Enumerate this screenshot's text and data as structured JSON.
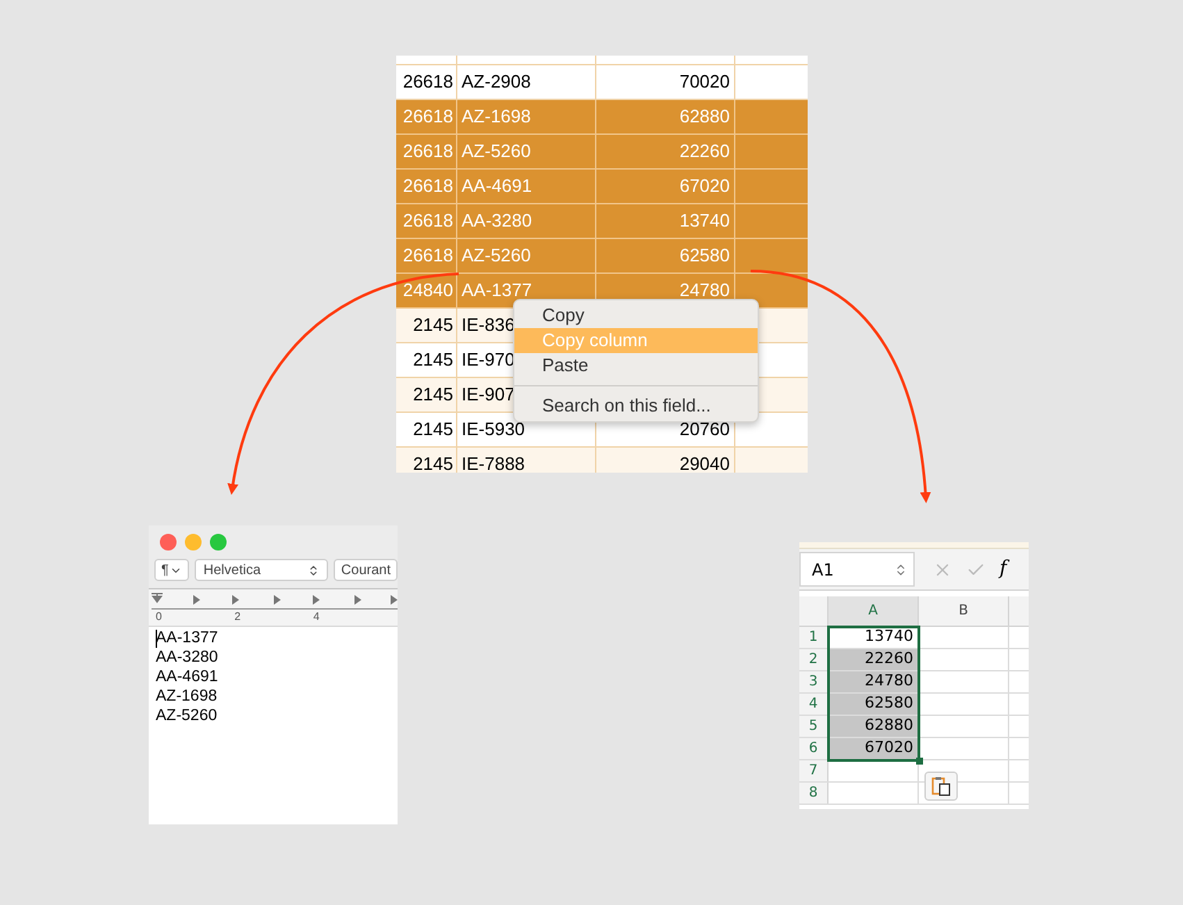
{
  "table": {
    "rows": [
      {
        "id": "26618",
        "code": "AZ-2908",
        "amount": "70020",
        "selected": false
      },
      {
        "id": "26618",
        "code": "AZ-1698",
        "amount": "62880",
        "selected": true
      },
      {
        "id": "26618",
        "code": "AZ-5260",
        "amount": "22260",
        "selected": true
      },
      {
        "id": "26618",
        "code": "AA-4691",
        "amount": "67020",
        "selected": true
      },
      {
        "id": "26618",
        "code": "AA-3280",
        "amount": "13740",
        "selected": true
      },
      {
        "id": "26618",
        "code": "AZ-5260",
        "amount": "62580",
        "selected": true
      },
      {
        "id": "24840",
        "code": "AA-1377",
        "amount": "24780",
        "selected": true
      },
      {
        "id": "2145",
        "code": "IE-836",
        "selected": false
      },
      {
        "id": "2145",
        "code": "IE-970",
        "selected": false
      },
      {
        "id": "2145",
        "code": "IE-907",
        "selected": false
      },
      {
        "id": "2145",
        "code": "IE-5930",
        "amount": "20760",
        "selected": false
      },
      {
        "id": "2145",
        "code": "IE-7888",
        "amount": "29040",
        "selected": false
      }
    ]
  },
  "context_menu": {
    "items": [
      {
        "kind": "item",
        "label": "Copy",
        "highlighted": false
      },
      {
        "kind": "item",
        "label": "Copy column",
        "highlighted": true
      },
      {
        "kind": "item",
        "label": "Paste",
        "highlighted": false
      },
      {
        "kind": "separator"
      },
      {
        "kind": "item",
        "label": "Search on this field...",
        "highlighted": false
      }
    ]
  },
  "text_editor": {
    "paragraph_menu": "¶",
    "font_family": "Helvetica",
    "font_style": "Courant",
    "ruler_labels": [
      "0",
      "2",
      "4"
    ],
    "lines": [
      "AA-1377",
      "AA-3280",
      "AA-4691",
      "AZ-1698",
      "AZ-5260"
    ]
  },
  "spreadsheet": {
    "name_box": "A1",
    "function_label": "f",
    "columns": [
      {
        "label": "A",
        "selected": true
      },
      {
        "label": "B",
        "selected": false
      }
    ],
    "rows": [
      {
        "number": "1",
        "value": "13740",
        "selected": false
      },
      {
        "number": "2",
        "value": "22260",
        "selected": true
      },
      {
        "number": "3",
        "value": "24780",
        "selected": true
      },
      {
        "number": "4",
        "value": "62580",
        "selected": true
      },
      {
        "number": "5",
        "value": "62880",
        "selected": true
      },
      {
        "number": "6",
        "value": "67020",
        "selected": true
      },
      {
        "number": "7",
        "selected": false
      },
      {
        "number": "8",
        "selected": false
      }
    ]
  }
}
